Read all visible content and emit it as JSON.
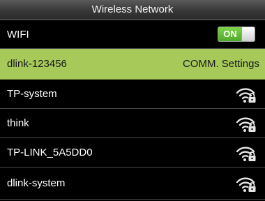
{
  "header": {
    "title": "Wireless Network"
  },
  "wifi": {
    "label": "WIFI",
    "toggle_label": "ON",
    "enabled": true
  },
  "selected_network": {
    "ssid": "dlink-123456",
    "action_label": "COMM. Settings"
  },
  "networks": [
    {
      "ssid": "TP-system",
      "icon": "wifi-lock-icon"
    },
    {
      "ssid": "think",
      "icon": "wifi-lock-icon"
    },
    {
      "ssid": "TP-LINK_5A5DD0",
      "icon": "wifi-lock-icon"
    },
    {
      "ssid": "dlink-system",
      "icon": "wifi-lock-icon"
    }
  ],
  "colors": {
    "background": "#000000",
    "selected_row": "#a6c95a",
    "toggle_on": "#4fa82a"
  }
}
